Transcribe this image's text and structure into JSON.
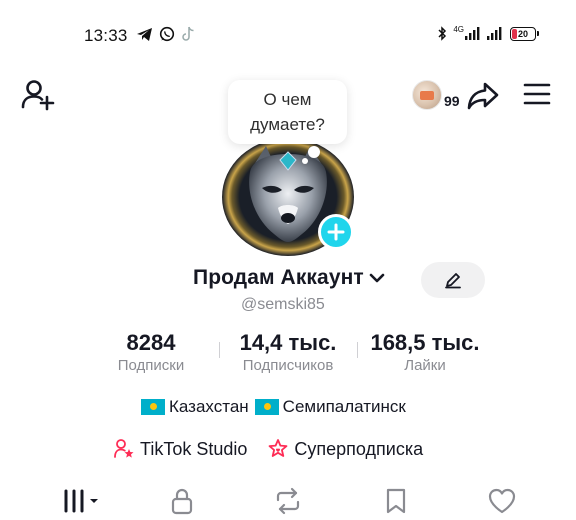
{
  "status_bar": {
    "time": "13:33",
    "left_icons": [
      "telegram-icon",
      "whatsapp-icon",
      "tiktok-icon"
    ],
    "right_icons": [
      "bluetooth-icon",
      "mobile-data-icon",
      "signal-icon",
      "battery-icon"
    ],
    "network_label": "4G",
    "battery_level": "20",
    "battery_color": "#e0304a"
  },
  "top_bar": {
    "inbox_count": "99"
  },
  "thought_bubble": {
    "text": "О чем думаете?"
  },
  "profile": {
    "name": "Продам Аккаунт",
    "username": "@semski85",
    "avatar_add_color": "#20d5ec"
  },
  "stats": [
    {
      "value": "8284",
      "label": "Подписки"
    },
    {
      "value": "14,4 тыс.",
      "label": "Подписчиков"
    },
    {
      "value": "168,5 тыс.",
      "label": "Лайки"
    }
  ],
  "location": {
    "country": "Казахстан",
    "city": "Семипалатинск"
  },
  "links": {
    "studio": "TikTok Studio",
    "subscription": "Суперподписка",
    "accent_color": "#fe2c55"
  },
  "tabs": [
    "videos-grid-icon",
    "lock-icon",
    "repost-icon",
    "bookmark-icon",
    "heart-icon"
  ]
}
